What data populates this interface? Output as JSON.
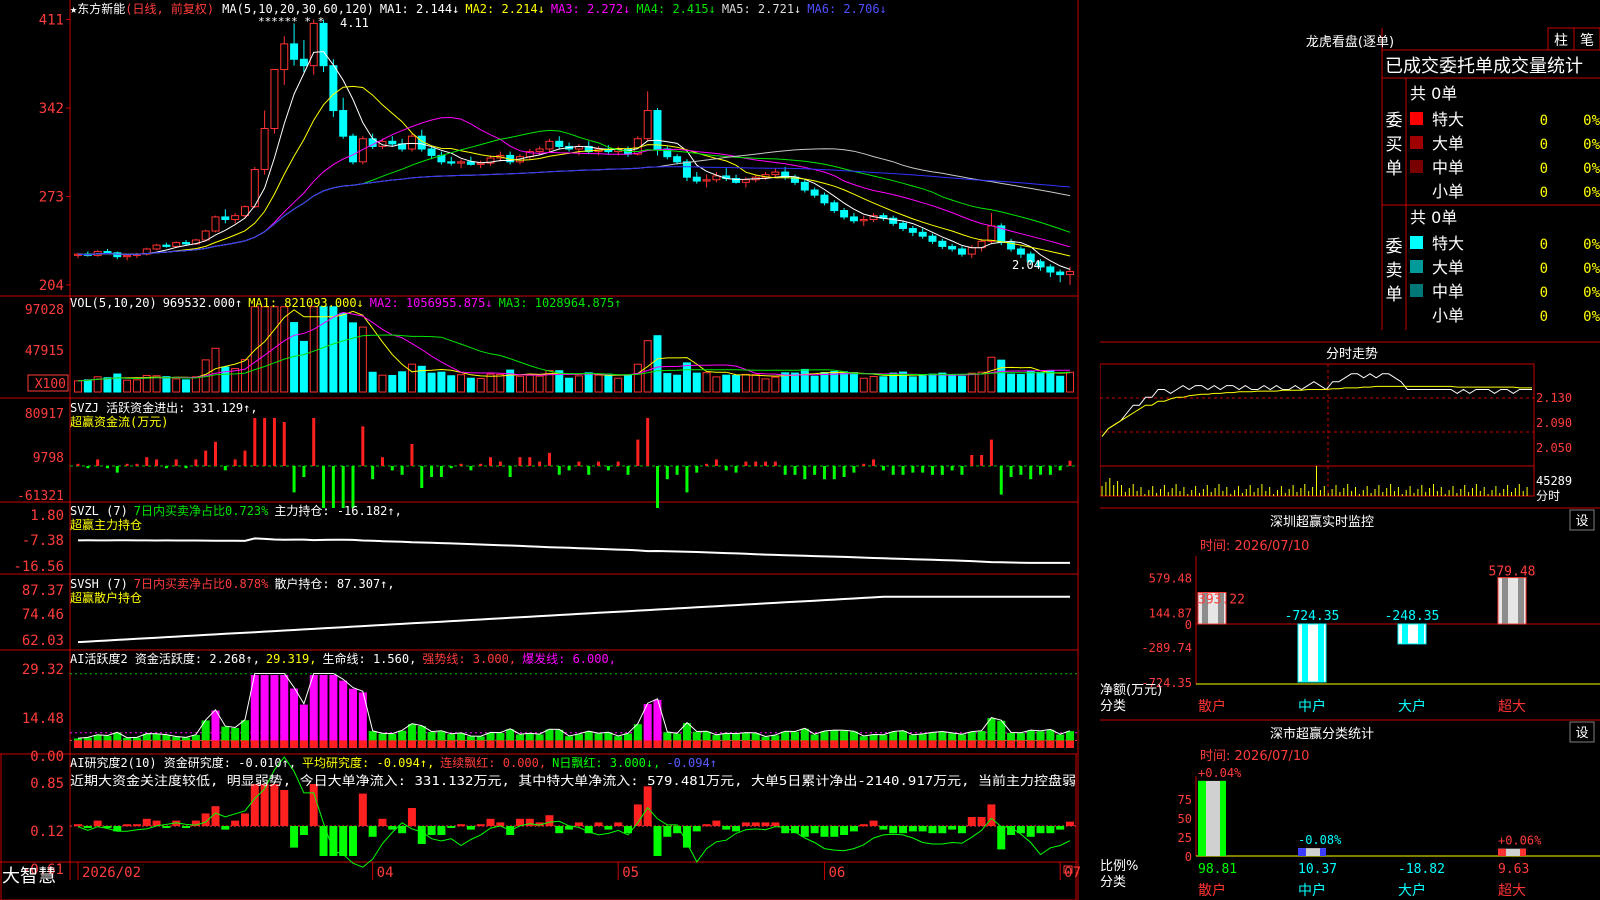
{
  "stock": {
    "name": "东方新能",
    "period": "(日线, 前复权)",
    "star_marks": "******  *  *",
    "high_mark": "4.11",
    "low_mark": "2.04"
  },
  "colors": {
    "up": "#ff3232",
    "down": "#00ffff",
    "ma1": "#ffffff",
    "ma2": "#ffff00",
    "ma3": "#ff00ff",
    "ma4": "#00e600",
    "ma5": "#c8c8c8",
    "ma6": "#3232ff",
    "grid": "#c80000",
    "text_red": "#ff3c3c"
  },
  "main_legend": {
    "ma_params": "MA(5,10,20,30,60,120)",
    "items": [
      {
        "text": "MA1: 2.144↓",
        "color": "#ffffff"
      },
      {
        "text": "MA2: 2.214↓",
        "color": "#ffff00"
      },
      {
        "text": "MA3: 2.272↓",
        "color": "#ff00ff"
      },
      {
        "text": "MA4: 2.415↓",
        "color": "#00e600"
      },
      {
        "text": "MA5: 2.721↓",
        "color": "#dcdcdc"
      },
      {
        "text": "MA6: 2.706↓",
        "color": "#5050ff"
      }
    ]
  },
  "vol_legend": {
    "params": "VOL(5,10,20)",
    "items": [
      {
        "text": "969532.000↑",
        "color": "#ffffff"
      },
      {
        "text": "MA1: 821093.000↓",
        "color": "#ffff00"
      },
      {
        "text": "MA2: 1056955.875↓",
        "color": "#ff00ff"
      },
      {
        "text": "MA3: 1028964.875↑",
        "color": "#00e600"
      }
    ]
  },
  "svzj_legend": {
    "line1": "SVZJ  活跃资金进出: 331.129↑,",
    "line2": "超赢资金流(万元)"
  },
  "svzl_legend": {
    "p1": "SVZL (7)",
    "p2": "7日内买卖净占比0.723%",
    "p3": "主力持仓: -16.182↑,",
    "line2": "超赢主力持仓"
  },
  "svsh_legend": {
    "p1": "SVSH (7)",
    "p2": "7日内买卖净占比0.878%",
    "p3": "散户持仓: 87.307↑,",
    "line2": "超赢散户持仓"
  },
  "ai_legend": {
    "items": [
      {
        "text": "AI活跃度2 资金活跃度: 2.268↑,",
        "color": "#ffffff"
      },
      {
        "text": "29.319,",
        "color": "#ffff00"
      },
      {
        "text": "生命线: 1.560,",
        "color": "#ffffff"
      },
      {
        "text": "强势线: 3.000,",
        "color": "#ff3c3c"
      },
      {
        "text": "爆发线: 6.000,",
        "color": "#ff00ff"
      }
    ]
  },
  "ai2_legend": {
    "items": [
      {
        "text": "AI研究度2(10) 资金研究度: -0.010↑,",
        "color": "#ffffff"
      },
      {
        "text": "平均研究度: -0.094↑,",
        "color": "#ffff00"
      },
      {
        "text": "连续飘红: 0.000,",
        "color": "#ff3c3c"
      },
      {
        "text": "N日飘红: 3.000↓,",
        "color": "#00ff00"
      },
      {
        "text": "-0.094↑",
        "color": "#5a5aff"
      }
    ],
    "comment": "近期大资金关注度较低, 明显弱势, 今日大单净流入: 331.132万元, 其中特大单净流入: 579.481万元, 大单5日累计净出-2140.917万元, 当前主力控盘弱"
  },
  "axes": {
    "price": [
      "411",
      "342",
      "273",
      "204"
    ],
    "vol": [
      "97028",
      "47915",
      "X100"
    ],
    "svzj": [
      "80917",
      "9798",
      "-61321"
    ],
    "svzl": [
      "1.80",
      "-7.38",
      "-16.56"
    ],
    "svsh": [
      "87.37",
      "74.46",
      "62.03"
    ],
    "ai": [
      "29.32",
      "14.48",
      "0.00"
    ],
    "ai2": [
      "0.85",
      "0.12",
      "-0.61"
    ],
    "dates": [
      "2026/02",
      "04",
      "05",
      "06",
      "07"
    ]
  },
  "footer": {
    "brand": "大智慧"
  },
  "right": {
    "lhb_title": "龙虎看盘(逐单)",
    "btn_zhu": "柱",
    "btn_bi": "笔",
    "header": "已成交委托单成交量统计",
    "buy_label": "委买单",
    "sell_label": "委卖单",
    "buy_total": "共 0单",
    "sell_total": "共 0单",
    "buy_rows": [
      {
        "label": "特大",
        "count": "0",
        "pct": "0%",
        "color": "#ff0000"
      },
      {
        "label": "大单",
        "count": "0",
        "pct": "0%",
        "color": "#a00000"
      },
      {
        "label": "中单",
        "count": "0",
        "pct": "0%",
        "color": "#780000"
      },
      {
        "label": "小单",
        "count": "0",
        "pct": "0%",
        "color": ""
      }
    ],
    "sell_rows": [
      {
        "label": "特大",
        "count": "0",
        "pct": "0%",
        "color": "#00ffff"
      },
      {
        "label": "大单",
        "count": "0",
        "pct": "0%",
        "color": "#009a9a"
      },
      {
        "label": "中单",
        "count": "0",
        "pct": "0%",
        "color": "#007878"
      },
      {
        "label": "小单",
        "count": "0",
        "pct": "0%",
        "color": ""
      }
    ],
    "fenshi": {
      "title": "分时走势",
      "prices": [
        "2.130",
        "2.090",
        "2.050"
      ],
      "vol_label": "45289",
      "vol_unit": "分时"
    },
    "monitor": {
      "title": "深圳超赢实时监控",
      "settings": "设",
      "time": "时间: 2026/07/10",
      "y_labels": [
        "579.48",
        "144.87",
        "0",
        "-289.74",
        "-724.35"
      ],
      "y_unit": "净额(万元)",
      "x_unit": "分类"
    },
    "classify": {
      "title": "深市超赢分类统计",
      "settings": "设",
      "time": "时间: 2026/07/10",
      "y_labels": [
        "75",
        "50",
        "25",
        "0"
      ],
      "y_unit": "比例%",
      "x_unit": "分类"
    }
  },
  "chart_data": [
    {
      "type": "bar",
      "title": "深圳超赢实时监控",
      "ylabel": "净额(万元)",
      "categories": [
        "散户",
        "中户",
        "大户",
        "超大"
      ],
      "values": [
        393.22,
        -724.35,
        -248.35,
        579.48
      ],
      "value_labels": [
        "393.22",
        "-724.35",
        "-248.35",
        "579.48"
      ],
      "ylim": [
        -724.35,
        579.48
      ]
    },
    {
      "type": "bar",
      "title": "深市超赢分类统计",
      "ylabel": "比例%",
      "categories": [
        "散户",
        "中户",
        "大户",
        "超大"
      ],
      "values": [
        98.81,
        10.37,
        -18.82,
        9.63
      ],
      "top_labels": [
        "+0.04%",
        "-0.08%",
        "",
        "+0.06%"
      ],
      "value_labels": [
        "98.81",
        "10.37",
        "-18.82",
        "9.63"
      ],
      "ylim": [
        0,
        100
      ]
    },
    {
      "type": "line",
      "title": "分时走势",
      "ylim": [
        2.03,
        2.15
      ],
      "prices": [
        2.06,
        2.07,
        2.075,
        2.08,
        2.09,
        2.1,
        2.1,
        2.11,
        2.11,
        2.12,
        2.12,
        2.115,
        2.12,
        2.125,
        2.12,
        2.125,
        2.125,
        2.12,
        2.125,
        2.12,
        2.125,
        2.125,
        2.12,
        2.125,
        2.12,
        2.12,
        2.125,
        2.12,
        2.125,
        2.12,
        2.12,
        2.125,
        2.12,
        2.125,
        2.13,
        2.125,
        2.12,
        2.13,
        2.13,
        2.135,
        2.14,
        2.14,
        2.135,
        2.14,
        2.135,
        2.14,
        2.14,
        2.135,
        2.13,
        2.12,
        2.12,
        2.12,
        2.12,
        2.12,
        2.12,
        2.12,
        2.12,
        2.115,
        2.12,
        2.115,
        2.12,
        2.12,
        2.12,
        2.115,
        2.12,
        2.12,
        2.115,
        2.12,
        2.12,
        2.12
      ],
      "avg": [
        2.06,
        2.07,
        2.075,
        2.08,
        2.085,
        2.09,
        2.095,
        2.1,
        2.1,
        2.105,
        2.105,
        2.108,
        2.11,
        2.11,
        2.112,
        2.113,
        2.114,
        2.114,
        2.115,
        2.115,
        2.116,
        2.116,
        2.117,
        2.117,
        2.117,
        2.118,
        2.118,
        2.118,
        2.118,
        2.119,
        2.119,
        2.119,
        2.119,
        2.12,
        2.12,
        2.12,
        2.12,
        2.121,
        2.121,
        2.122,
        2.122,
        2.122,
        2.123,
        2.123,
        2.124,
        2.124,
        2.124,
        2.124,
        2.124,
        2.124,
        2.124,
        2.124,
        2.124,
        2.124,
        2.124,
        2.124,
        2.124,
        2.123,
        2.123,
        2.123,
        2.123,
        2.123,
        2.123,
        2.123,
        2.123,
        2.123,
        2.123,
        2.122,
        2.122,
        2.122
      ]
    },
    {
      "type": "candlestick",
      "title": "东方新能 日线",
      "ohlc": [
        [
          2.27,
          2.29,
          2.25,
          2.28
        ],
        [
          2.28,
          2.3,
          2.26,
          2.27
        ],
        [
          2.27,
          2.31,
          2.26,
          2.3
        ],
        [
          2.3,
          2.32,
          2.28,
          2.29
        ],
        [
          2.29,
          2.3,
          2.24,
          2.26
        ],
        [
          2.26,
          2.28,
          2.23,
          2.27
        ],
        [
          2.27,
          2.29,
          2.25,
          2.28
        ],
        [
          2.28,
          2.33,
          2.27,
          2.32
        ],
        [
          2.32,
          2.36,
          2.31,
          2.35
        ],
        [
          2.35,
          2.37,
          2.33,
          2.34
        ],
        [
          2.34,
          2.38,
          2.33,
          2.37
        ],
        [
          2.37,
          2.39,
          2.35,
          2.36
        ],
        [
          2.36,
          2.4,
          2.35,
          2.39
        ],
        [
          2.39,
          2.47,
          2.38,
          2.46
        ],
        [
          2.46,
          2.58,
          2.45,
          2.57
        ],
        [
          2.57,
          2.63,
          2.52,
          2.55
        ],
        [
          2.55,
          2.6,
          2.52,
          2.58
        ],
        [
          2.58,
          2.66,
          2.56,
          2.65
        ],
        [
          2.65,
          2.96,
          2.64,
          2.94
        ],
        [
          2.94,
          3.4,
          2.9,
          3.26
        ],
        [
          3.26,
          3.72,
          3.22,
          3.72
        ],
        [
          3.72,
          3.98,
          3.6,
          3.92
        ],
        [
          3.92,
          4.08,
          3.75,
          3.8
        ],
        [
          3.8,
          3.95,
          3.7,
          3.75
        ],
        [
          3.75,
          4.11,
          3.68,
          4.08
        ],
        [
          4.08,
          4.11,
          3.7,
          3.75
        ],
        [
          3.75,
          3.8,
          3.35,
          3.4
        ],
        [
          3.4,
          3.5,
          3.18,
          3.2
        ],
        [
          3.2,
          3.22,
          2.98,
          3.0
        ],
        [
          3.0,
          3.2,
          2.98,
          3.18
        ],
        [
          3.18,
          3.22,
          3.1,
          3.12
        ],
        [
          3.12,
          3.18,
          3.1,
          3.16
        ],
        [
          3.16,
          3.2,
          3.12,
          3.14
        ],
        [
          3.14,
          3.18,
          3.08,
          3.1
        ],
        [
          3.1,
          3.22,
          3.08,
          3.2
        ],
        [
          3.2,
          3.25,
          3.08,
          3.1
        ],
        [
          3.1,
          3.12,
          3.02,
          3.05
        ],
        [
          3.05,
          3.08,
          2.98,
          3.0
        ],
        [
          3.0,
          3.04,
          2.97,
          2.99
        ],
        [
          2.99,
          3.02,
          2.95,
          3.0
        ],
        [
          3.0,
          3.04,
          2.97,
          2.98
        ],
        [
          2.98,
          3.01,
          2.95,
          2.99
        ],
        [
          2.99,
          3.05,
          2.97,
          3.03
        ],
        [
          3.03,
          3.08,
          3.0,
          3.05
        ],
        [
          3.05,
          3.08,
          2.98,
          3.0
        ],
        [
          3.0,
          3.06,
          2.98,
          3.04
        ],
        [
          3.04,
          3.1,
          3.02,
          3.08
        ],
        [
          3.08,
          3.12,
          3.05,
          3.1
        ],
        [
          3.1,
          3.18,
          3.08,
          3.16
        ],
        [
          3.16,
          3.2,
          3.1,
          3.12
        ],
        [
          3.12,
          3.15,
          3.08,
          3.1
        ],
        [
          3.1,
          3.14,
          3.05,
          3.12
        ],
        [
          3.12,
          3.16,
          3.06,
          3.08
        ],
        [
          3.08,
          3.12,
          3.05,
          3.1
        ],
        [
          3.1,
          3.13,
          3.06,
          3.08
        ],
        [
          3.08,
          3.12,
          3.05,
          3.1
        ],
        [
          3.1,
          3.12,
          3.04,
          3.06
        ],
        [
          3.06,
          3.2,
          3.05,
          3.18
        ],
        [
          3.18,
          3.55,
          3.16,
          3.4
        ],
        [
          3.4,
          3.42,
          3.05,
          3.1
        ],
        [
          3.1,
          3.12,
          3.02,
          3.04
        ],
        [
          3.04,
          3.06,
          2.98,
          3.0
        ],
        [
          3.0,
          3.02,
          2.85,
          2.88
        ],
        [
          2.88,
          2.92,
          2.83,
          2.85
        ],
        [
          2.85,
          2.9,
          2.8,
          2.86
        ],
        [
          2.86,
          2.92,
          2.84,
          2.89
        ],
        [
          2.89,
          2.95,
          2.85,
          2.87
        ],
        [
          2.87,
          2.9,
          2.83,
          2.84
        ],
        [
          2.84,
          2.88,
          2.8,
          2.86
        ],
        [
          2.86,
          2.9,
          2.84,
          2.88
        ],
        [
          2.88,
          2.92,
          2.86,
          2.9
        ],
        [
          2.9,
          2.95,
          2.88,
          2.92
        ],
        [
          2.92,
          2.96,
          2.86,
          2.88
        ],
        [
          2.88,
          2.9,
          2.82,
          2.84
        ],
        [
          2.84,
          2.86,
          2.76,
          2.78
        ],
        [
          2.78,
          2.8,
          2.72,
          2.74
        ],
        [
          2.74,
          2.76,
          2.66,
          2.68
        ],
        [
          2.68,
          2.7,
          2.6,
          2.62
        ],
        [
          2.62,
          2.64,
          2.55,
          2.57
        ],
        [
          2.57,
          2.6,
          2.52,
          2.54
        ],
        [
          2.54,
          2.58,
          2.5,
          2.55
        ],
        [
          2.55,
          2.6,
          2.53,
          2.58
        ],
        [
          2.58,
          2.6,
          2.54,
          2.56
        ],
        [
          2.56,
          2.58,
          2.5,
          2.52
        ],
        [
          2.52,
          2.54,
          2.46,
          2.48
        ],
        [
          2.48,
          2.5,
          2.42,
          2.45
        ],
        [
          2.45,
          2.48,
          2.4,
          2.42
        ],
        [
          2.42,
          2.44,
          2.36,
          2.38
        ],
        [
          2.38,
          2.4,
          2.32,
          2.34
        ],
        [
          2.34,
          2.36,
          2.3,
          2.32
        ],
        [
          2.32,
          2.34,
          2.26,
          2.28
        ],
        [
          2.28,
          2.35,
          2.25,
          2.33
        ],
        [
          2.33,
          2.4,
          2.3,
          2.38
        ],
        [
          2.38,
          2.6,
          2.36,
          2.5
        ],
        [
          2.5,
          2.52,
          2.35,
          2.37
        ],
        [
          2.37,
          2.4,
          2.3,
          2.32
        ],
        [
          2.32,
          2.34,
          2.25,
          2.28
        ],
        [
          2.28,
          2.3,
          2.2,
          2.22
        ],
        [
          2.22,
          2.24,
          2.15,
          2.18
        ],
        [
          2.18,
          2.2,
          2.1,
          2.14
        ],
        [
          2.14,
          2.16,
          2.06,
          2.12
        ],
        [
          2.12,
          2.18,
          2.04,
          2.144
        ]
      ]
    }
  ]
}
